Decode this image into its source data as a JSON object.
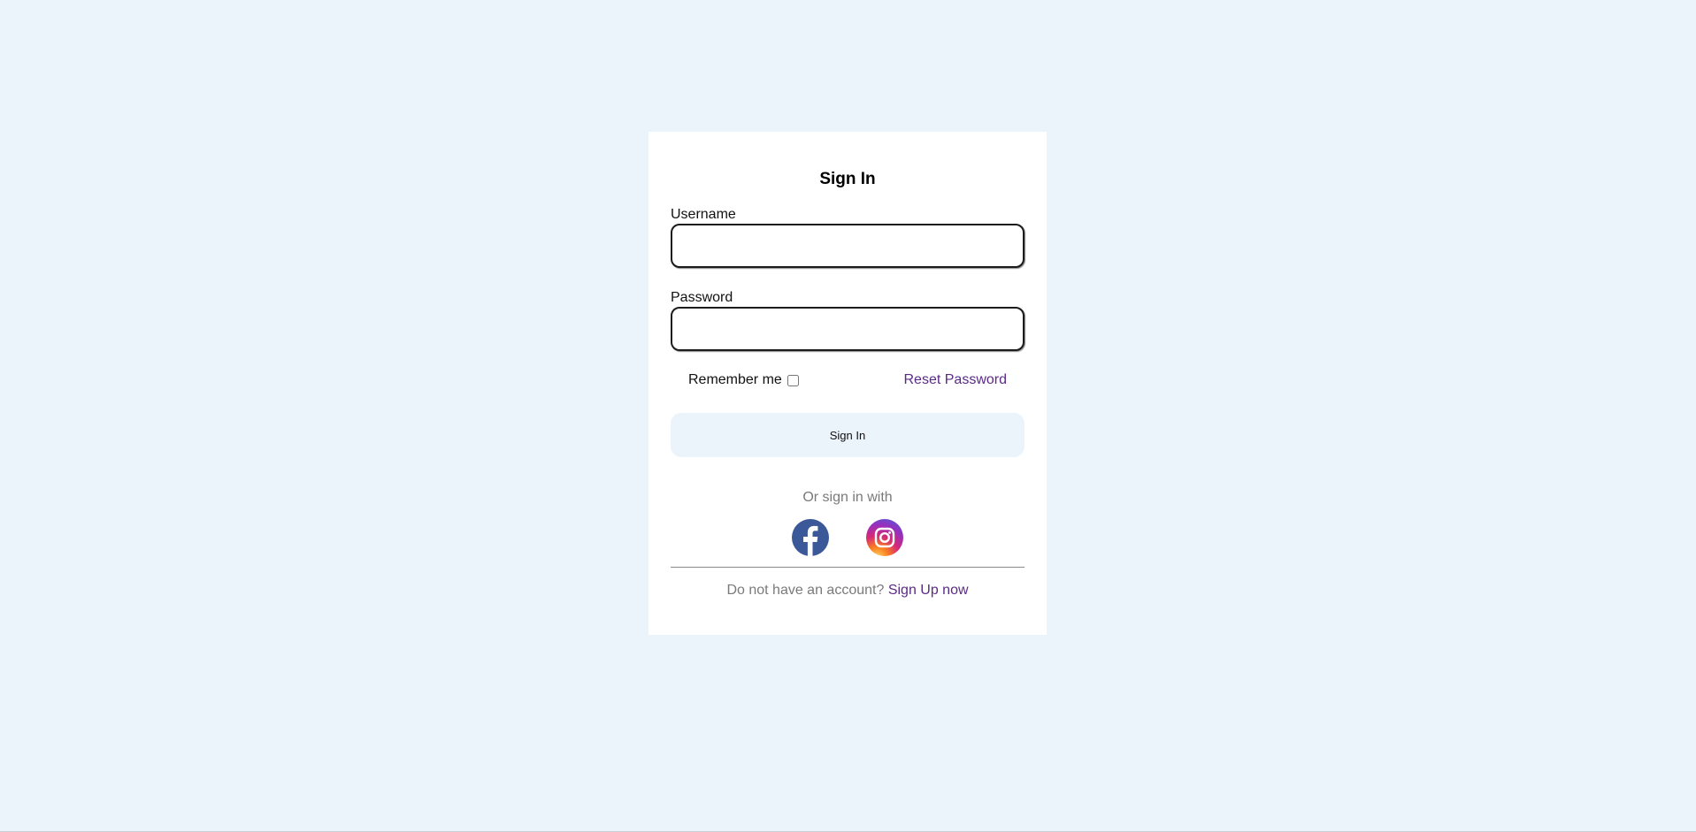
{
  "form": {
    "title": "Sign In",
    "username_label": "Username",
    "username_value": "",
    "password_label": "Password",
    "password_value": "",
    "remember_label": "Remember me",
    "remember_checked": false,
    "reset_link": "Reset Password",
    "submit_label": "Sign In",
    "or_text": "Or sign in with",
    "socials": [
      {
        "name": "facebook",
        "icon": "facebook-icon",
        "color": "#3b5998"
      },
      {
        "name": "instagram",
        "icon": "instagram-icon",
        "color": "#e1306c"
      }
    ],
    "signup_prompt": "Do not have an account?",
    "signup_link": "Sign Up now"
  },
  "colors": {
    "background": "#ebf3fb",
    "card": "#ffffff",
    "link": "#5b2a86",
    "muted_text": "#7a7a7a"
  }
}
